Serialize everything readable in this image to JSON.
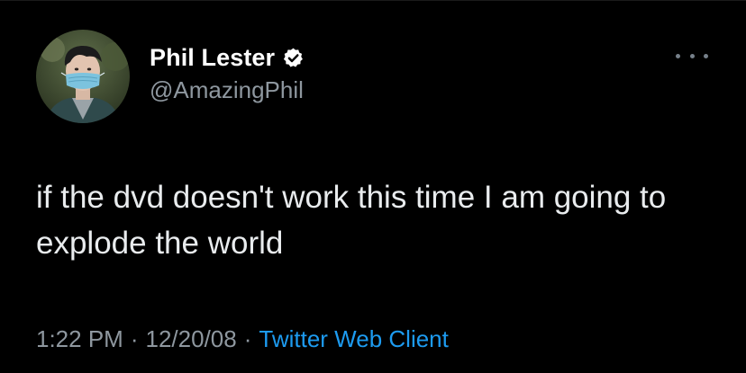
{
  "author": {
    "display_name": "Phil Lester",
    "handle": "@AmazingPhil",
    "verified_icon": "verified-badge-icon",
    "avatar_icon": "profile-photo"
  },
  "tweet": {
    "text": "if the dvd doesn't work this time I am going to explode the world"
  },
  "meta": {
    "time": "1:22 PM",
    "separator": "·",
    "date": "12/20/08",
    "client": "Twitter Web Client"
  },
  "colors": {
    "background": "#000000",
    "primary_text": "#e9ecee",
    "secondary_text": "#8e979f",
    "link": "#1d9bf0"
  }
}
